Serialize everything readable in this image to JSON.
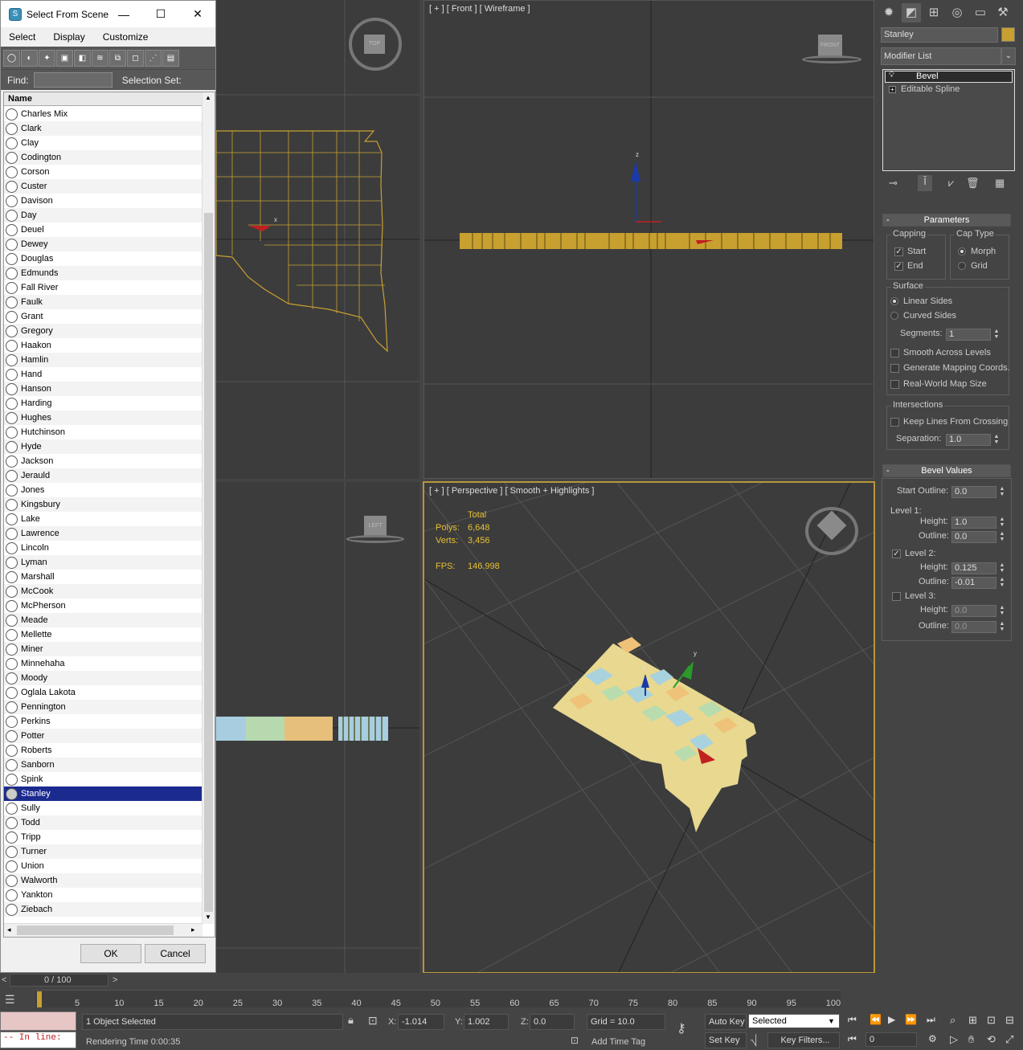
{
  "dialog": {
    "title": "Select From Scene",
    "menu": [
      "Select",
      "Display",
      "Customize"
    ],
    "find_label": "Find:",
    "find_value": "",
    "selection_set_label": "Selection Set:",
    "column_header": "Name",
    "items": [
      "Charles Mix",
      "Clark",
      "Clay",
      "Codington",
      "Corson",
      "Custer",
      "Davison",
      "Day",
      "Deuel",
      "Dewey",
      "Douglas",
      "Edmunds",
      "Fall River",
      "Faulk",
      "Grant",
      "Gregory",
      "Haakon",
      "Hamlin",
      "Hand",
      "Hanson",
      "Harding",
      "Hughes",
      "Hutchinson",
      "Hyde",
      "Jackson",
      "Jerauld",
      "Jones",
      "Kingsbury",
      "Lake",
      "Lawrence",
      "Lincoln",
      "Lyman",
      "Marshall",
      "McCook",
      "McPherson",
      "Meade",
      "Mellette",
      "Miner",
      "Minnehaha",
      "Moody",
      "Oglala Lakota",
      "Pennington",
      "Perkins",
      "Potter",
      "Roberts",
      "Sanborn",
      "Spink",
      "Stanley",
      "Sully",
      "Todd",
      "Tripp",
      "Turner",
      "Union",
      "Walworth",
      "Yankton",
      "Ziebach"
    ],
    "selected_item": "Stanley",
    "ok_label": "OK",
    "cancel_label": "Cancel",
    "window_buttons": {
      "minimize": "—",
      "maximize": "☐",
      "close": "✕"
    }
  },
  "viewports": {
    "front_label": "[ + ] [ Front ] [ Wireframe ]",
    "perspective_label": "[ + ] [ Perspective ] [ Smooth + Highlights ]",
    "top_cube": "TOP",
    "front_cube": "FRONT",
    "left_cube": "LEFT",
    "stats": {
      "header": "Total",
      "polys_label": "Polys:",
      "polys_value": "6,648",
      "verts_label": "Verts:",
      "verts_value": "3,456",
      "fps_label": "FPS:",
      "fps_value": "146.998"
    }
  },
  "command_panel": {
    "object_name": "Stanley",
    "object_color": "#c8a030",
    "modifier_list": "Modifier List",
    "stack": [
      "Bevel",
      "Editable Spline"
    ],
    "parameters_title": "Parameters",
    "capping_label": "Capping",
    "cap_start": "Start",
    "cap_end": "End",
    "cap_type_label": "Cap Type",
    "morph": "Morph",
    "grid": "Grid",
    "surface_label": "Surface",
    "linear_sides": "Linear Sides",
    "curved_sides": "Curved Sides",
    "segments_label": "Segments:",
    "segments_value": "1",
    "smooth_across": "Smooth Across Levels",
    "gen_mapping": "Generate Mapping Coords.",
    "real_world": "Real-World Map Size",
    "intersections_label": "Intersections",
    "keep_lines": "Keep Lines From Crossing",
    "separation_label": "Separation:",
    "separation_value": "1.0",
    "bevel_values_title": "Bevel Values",
    "start_outline_label": "Start Outline:",
    "start_outline_value": "0.0",
    "level1_label": "Level 1:",
    "height_label": "Height:",
    "outline_label": "Outline:",
    "l1_height": "1.0",
    "l1_outline": "0.0",
    "level2_label": "Level 2:",
    "l2_height": "0.125",
    "l2_outline": "-0.01",
    "level3_label": "Level 3:",
    "l3_height": "0.0",
    "l3_outline": "0.0"
  },
  "timeline": {
    "frame_display": "0 / 100",
    "ticks": [
      "5",
      "10",
      "15",
      "20",
      "25",
      "30",
      "35",
      "40",
      "45",
      "50",
      "55",
      "60",
      "65",
      "70",
      "75",
      "80",
      "85",
      "90",
      "95",
      "100"
    ]
  },
  "status": {
    "maxscript": "-- In line:",
    "selected": "1 Object Selected",
    "rendering_time": "Rendering Time  0:00:35",
    "x_label": "X:",
    "x_value": "-1.014",
    "y_label": "Y:",
    "y_value": "1.002",
    "z_label": "Z:",
    "z_value": "0.0",
    "grid": "Grid = 10.0",
    "add_time_tag": "Add Time Tag",
    "auto_key": "Auto Key",
    "set_key": "Set Key",
    "selected_dropdown": "Selected",
    "key_filters": "Key Filters...",
    "current_frame": "0"
  }
}
